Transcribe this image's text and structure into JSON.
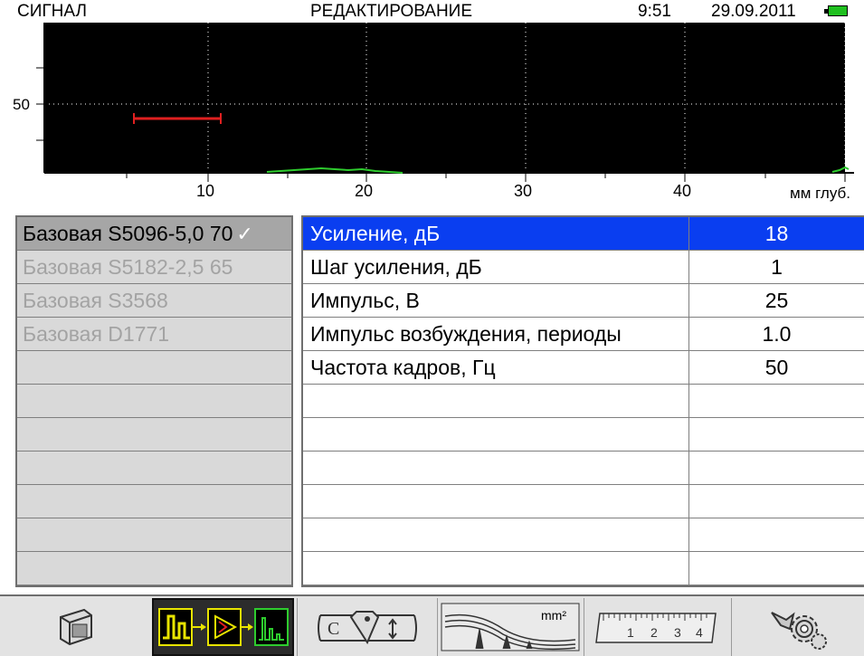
{
  "status": {
    "mode": "СИГНАЛ",
    "title": "РЕДАКТИРОВАНИЕ",
    "time": "9:51",
    "date": "29.09.2011",
    "battery_color": "#1fbf1f"
  },
  "plot": {
    "y_label": "50",
    "x_ticks": [
      "10",
      "20",
      "30",
      "40"
    ],
    "x_unit": "мм глуб.",
    "gate_color": "#e02020",
    "signal_color": "#2ecc2e"
  },
  "probes": [
    {
      "label": "Базовая S5096-5,0 70",
      "active": true
    },
    {
      "label": "Базовая S5182-2,5 65",
      "active": false
    },
    {
      "label": "Базовая S3568",
      "active": false
    },
    {
      "label": "Базовая D1771",
      "active": false
    },
    {
      "label": "",
      "active": false
    },
    {
      "label": "",
      "active": false
    },
    {
      "label": "",
      "active": false
    },
    {
      "label": "",
      "active": false
    },
    {
      "label": "",
      "active": false
    },
    {
      "label": "",
      "active": false
    },
    {
      "label": "",
      "active": false
    }
  ],
  "check_mark": "✓",
  "params": [
    {
      "name": "Усиление, дБ",
      "value": "18"
    },
    {
      "name": "Шаг усиления, дБ",
      "value": "1"
    },
    {
      "name": "Импульс, В",
      "value": "25"
    },
    {
      "name": "Импульс возбуждения, периоды",
      "value": "1.0"
    },
    {
      "name": "Частота кадров, Гц",
      "value": "50"
    },
    {
      "name": "",
      "value": ""
    },
    {
      "name": "",
      "value": ""
    },
    {
      "name": "",
      "value": ""
    },
    {
      "name": "",
      "value": ""
    },
    {
      "name": "",
      "value": ""
    },
    {
      "name": "",
      "value": ""
    }
  ],
  "toolbar": {
    "icons": [
      "transducer-icon",
      "signal-chain-icon",
      "probe-calibration-icon",
      "tvg-curve-icon",
      "ruler-icon",
      "settings-gears-icon"
    ],
    "tvg_unit": "mm²",
    "ruler_numbers": [
      "1",
      "2",
      "3",
      "4"
    ],
    "calib_letter": "C"
  },
  "colors": {
    "selection": "#0a3ef0",
    "plot_bg": "#000000",
    "panel_bg": "#d9d9d9"
  }
}
